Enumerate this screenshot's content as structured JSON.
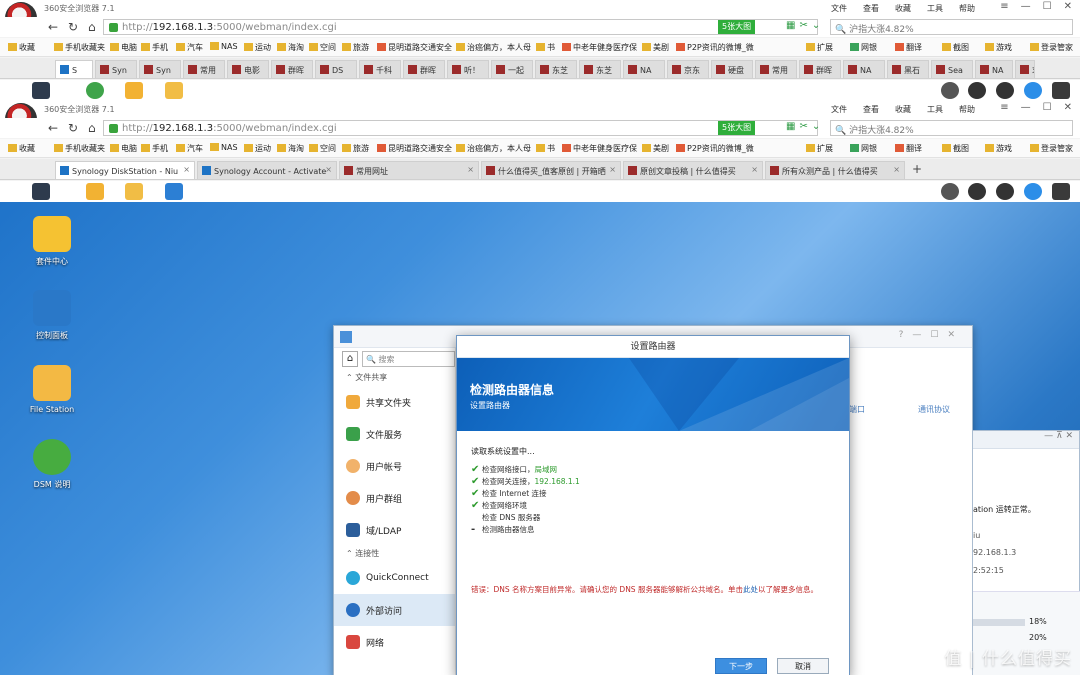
{
  "browser": {
    "app_title": "360安全浏览器 7.1",
    "menu": [
      "文件",
      "查看",
      "收藏",
      "工具",
      "帮助"
    ],
    "url_prefix": "http://",
    "url_host": "192.168.1.3",
    "url_path": ":5000/webman/index.cgi",
    "badge": "5张大图",
    "search": "沪指大涨4.82%",
    "bookmarks": [
      "收藏",
      "手机收藏夹",
      "电脑",
      "手机",
      "汽车",
      "NAS",
      "运动",
      "海淘",
      "空间",
      "旅游",
      "昆明道路交通安全",
      "治癌偏方，本人母",
      "书",
      "中老年健身医疗保",
      "美剧",
      "P2P资讯的微博_微"
    ],
    "bookmarks_right": [
      "扩展",
      "网银",
      "翻译",
      "截图",
      "游戏",
      "登录管家"
    ],
    "tabs_top": [
      "S",
      "Syn",
      "Syn",
      "常用",
      "电影",
      "群晖",
      "DS",
      "千科",
      "群晖",
      "听！",
      "一起",
      "东芝",
      "东芝",
      "NA",
      "京东",
      "硬盘",
      "常用",
      "群晖",
      "NA",
      "黑石",
      "Sea",
      "NA",
      "求个"
    ],
    "tabs_bottom": [
      "Synology DiskStation - Niu",
      "Synology Account - Activate",
      "常用网址",
      "什么值得买_值客原创 | 开箱晒",
      "原创文章投稿 | 什么值得买",
      "所有众测产品 | 什么值得买"
    ]
  },
  "desktop": {
    "icons": [
      "套件中心",
      "控制面板",
      "File Station",
      "DSM 说明"
    ]
  },
  "control_panel": {
    "search_placeholder": "搜索",
    "section_file": "文件共享",
    "items": [
      "共享文件夹",
      "文件服务",
      "用户帐号",
      "用户群组",
      "域/LDAP"
    ],
    "section_conn": "连接性",
    "conn_items": [
      "QuickConnect",
      "外部访问",
      "网络"
    ],
    "col1": "端口",
    "col2": "通讯协议"
  },
  "right_window": {
    "line1": "ation 运转正常。",
    "line2": "iu",
    "ip": "92.168.1.3",
    "time": "2:52:15",
    "p1": "18%",
    "p2": "20%"
  },
  "modal": {
    "title": "设置路由器",
    "heading": "检测路由器信息",
    "subheading": "设置路由器",
    "reading": "读取系统设置中...",
    "steps": [
      {
        "text": "检查网络接口，",
        "value": "局域网",
        "done": true
      },
      {
        "text": "检查网关连接，",
        "value": "192.168.1.1",
        "done": true
      },
      {
        "text": "检查 Internet 连接",
        "value": "",
        "done": true
      },
      {
        "text": "检查网络环境",
        "value": "",
        "done": true
      },
      {
        "text": "检查 DNS 服务器",
        "value": "",
        "done": false
      },
      {
        "text": "检测路由器信息",
        "value": "",
        "done": false
      }
    ],
    "error": "错误：DNS 名称方案目前异常。请确认您的 DNS 服务器能够解析公共域名。单击",
    "error_link": "此处",
    "error_tail": "以了解更多信息。",
    "next": "下一步",
    "cancel": "取消"
  },
  "watermark": "值 | 什么值得买",
  "colors": {
    "accent": "#1e7fd9",
    "error": "#c02b2b",
    "check": "#2e9b2e"
  }
}
